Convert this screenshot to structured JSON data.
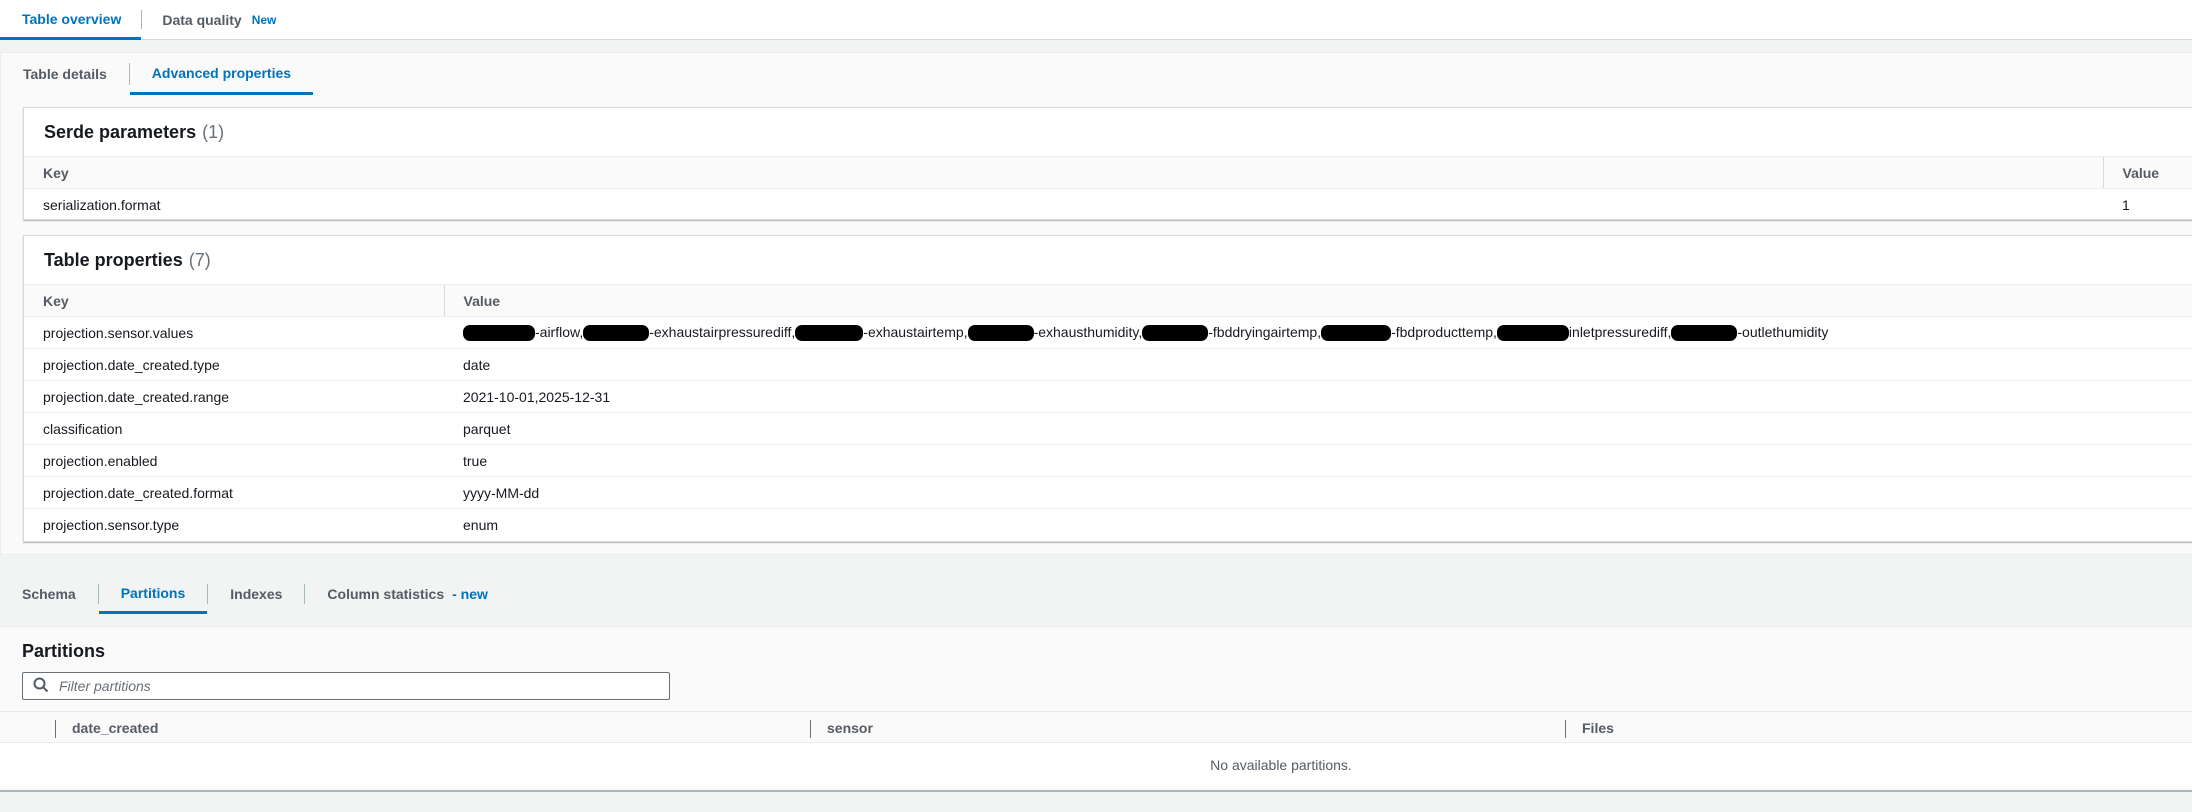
{
  "top_tabs": [
    {
      "label": "Table overview",
      "active": true
    },
    {
      "label": "Data quality",
      "badge": "New",
      "active": false
    }
  ],
  "sub_tabs": [
    {
      "label": "Table details",
      "active": false
    },
    {
      "label": "Advanced properties",
      "active": true
    }
  ],
  "serde": {
    "title": "Serde parameters",
    "count": "(1)",
    "columns": [
      "Key",
      "Value"
    ],
    "rows": [
      {
        "key": "serialization.format",
        "value": "1"
      }
    ]
  },
  "table_properties": {
    "title": "Table properties",
    "count": "(7)",
    "columns": [
      "Key",
      "Value"
    ],
    "sensor_values_parts": [
      "-airflow,",
      "-exhaustairpressurediff,",
      "-exhaustairtemp,",
      "-exhausthumidity,",
      "-fbddryingairtemp,",
      "-fbdproducttemp,",
      "inletpressurediff,",
      "-outlethumidity"
    ],
    "rows": [
      {
        "key": "projection.sensor.values",
        "value": ""
      },
      {
        "key": "projection.date_created.type",
        "value": "date"
      },
      {
        "key": "projection.date_created.range",
        "value": "2021-10-01,2025-12-31"
      },
      {
        "key": "classification",
        "value": "parquet"
      },
      {
        "key": "projection.enabled",
        "value": "true"
      },
      {
        "key": "projection.date_created.format",
        "value": "yyyy-MM-dd"
      },
      {
        "key": "projection.sensor.type",
        "value": "enum"
      }
    ]
  },
  "bottom_tabs": [
    {
      "label": "Schema",
      "active": false
    },
    {
      "label": "Partitions",
      "active": true
    },
    {
      "label": "Indexes",
      "active": false
    },
    {
      "label": "Column statistics",
      "suffix": "- new",
      "active": false
    }
  ],
  "partitions": {
    "title": "Partitions",
    "search_placeholder": "Filter partitions",
    "columns": [
      "date_created",
      "sensor",
      "Files"
    ],
    "empty_message": "No available partitions."
  },
  "icons": {
    "search": "search-icon"
  },
  "colors": {
    "accent": "#0073bb",
    "text": "#16191f",
    "muted": "#545b64"
  }
}
